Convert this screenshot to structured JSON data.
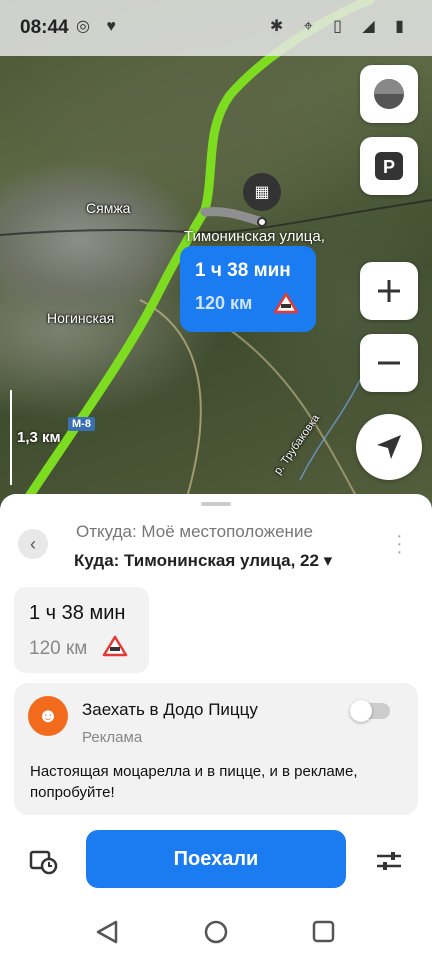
{
  "status_bar": {
    "time": "08:44"
  },
  "map": {
    "place_labels": [
      "Сямжа",
      "Ногинская"
    ],
    "destination_label": "Тимонинская улица,",
    "road_shield": "М-8",
    "river_label": "р. Трубаковка",
    "scale": "1,3 км",
    "route_bubble": {
      "time": "1 ч 38 мин",
      "distance": "120 км"
    }
  },
  "sheet": {
    "from": "Откуда: Моё местоположение",
    "to": "Куда: Тимонинская улица, 22 ▾",
    "route_card": {
      "time": "1 ч 38 мин",
      "distance": "120 км"
    },
    "ad": {
      "title": "Заехать в Додо Пиццу",
      "label": "Реклама",
      "text": "Настоящая моцарелла и в пицце, и в рекламе, попробуйте!",
      "toggle_on": false
    },
    "go_button": "Поехали"
  },
  "colors": {
    "accent": "#1a7cf0",
    "route": "#7ddc1f",
    "ad_logo": "#f26b1d"
  }
}
